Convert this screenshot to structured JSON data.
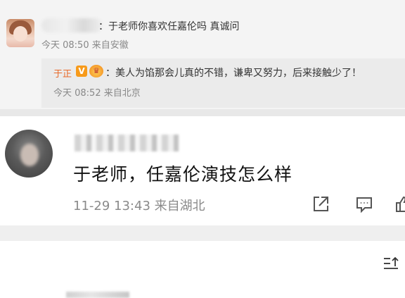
{
  "top_comment": {
    "text": "：于老师你喜欢任嘉伦吗 真诚问",
    "meta": "今天 08:50 来自安徽"
  },
  "reply": {
    "author": "于正",
    "verified_badge": "V",
    "text": "：美人为馅那会儿真的不错，谦卑又努力，后来接触少了！",
    "meta": "今天 08:52 来自北京"
  },
  "main_comment": {
    "text": "于老师，任嘉伦演技怎么样",
    "meta": "11-29 13:43 来自湖北"
  },
  "actions": {
    "share_icon": "share-icon",
    "comment_icon": "comment-icon",
    "like_icon": "like-icon",
    "sort_icon": "sort-icon"
  },
  "colors": {
    "author_orange": "#e86a2a",
    "badge_orange": "#f79a1a",
    "meta_gray": "#888888"
  }
}
